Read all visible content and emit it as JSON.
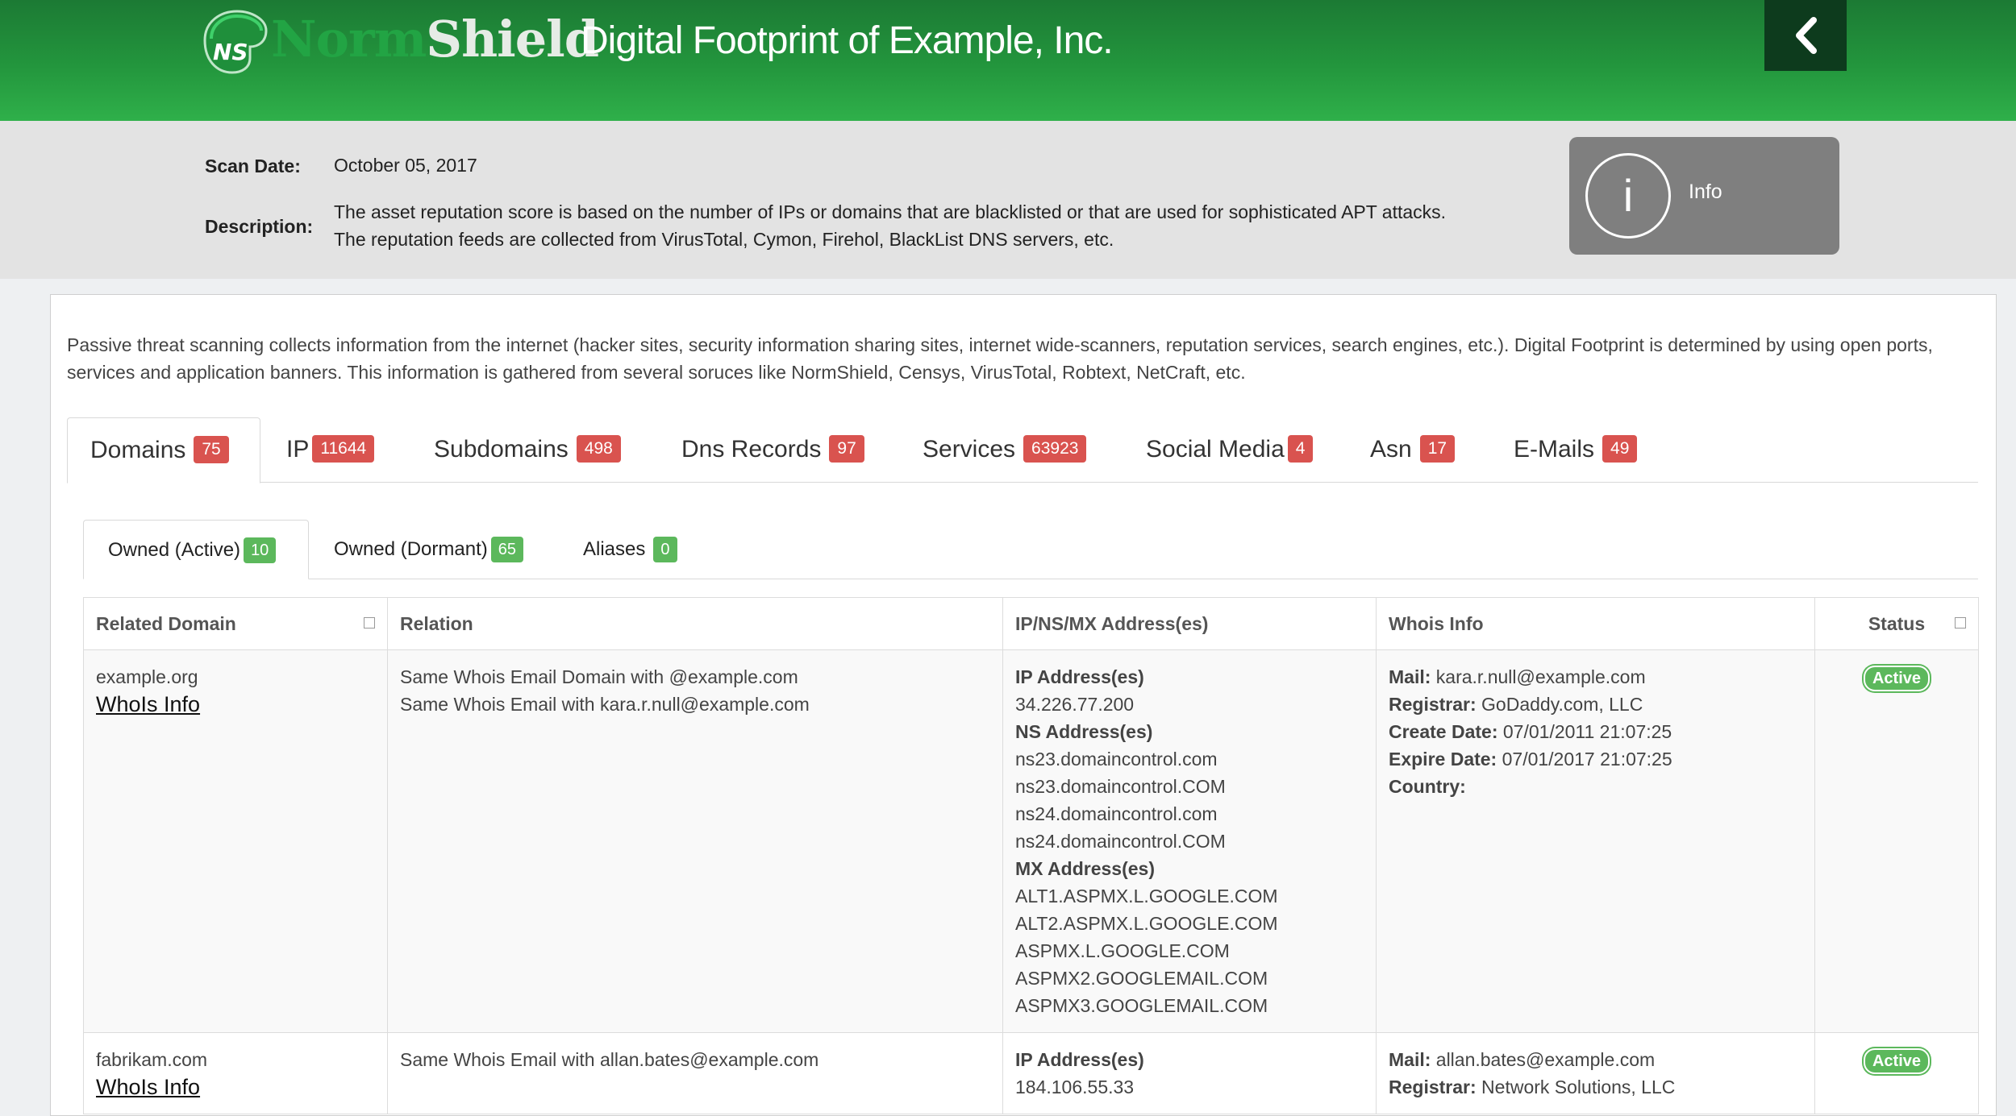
{
  "header": {
    "logo_badge": "NS",
    "logo_norm": "Norm",
    "logo_shield": "Shield",
    "title": "Digital Footprint of Example, Inc.",
    "back_icon": "chevron-left-icon"
  },
  "scan_info": {
    "scan_date_label": "Scan Date:",
    "scan_date": "October 05, 2017",
    "description_label": "Description:",
    "description_line1": "The asset reputation score is based on the number of IPs or domains that are blacklisted or that are used for sophisticated APT attacks.",
    "description_line2": "The reputation feeds are collected from VirusTotal, Cymon, Firehol, BlackList DNS servers, etc.",
    "info_icon_glyph": "i",
    "info_label": "Info"
  },
  "intro": "Passive threat scanning collects information from the internet (hacker sites, security information sharing sites, internet wide-scanners, reputation services, search engines, etc.). Digital Footprint is determined by using open ports, services and application banners. This information is gathered from several soruces like NormShield, Censys, VirusTotal, Robtext, NetCraft, etc.",
  "tabs": [
    {
      "label": "Domains",
      "count": "75"
    },
    {
      "label": "IP",
      "count": "11644"
    },
    {
      "label": "Subdomains",
      "count": "498"
    },
    {
      "label": "Dns Records",
      "count": "97"
    },
    {
      "label": "Services",
      "count": "63923"
    },
    {
      "label": "Social Media",
      "count": "4"
    },
    {
      "label": "Asn",
      "count": "17"
    },
    {
      "label": "E-Mails",
      "count": "49"
    }
  ],
  "subtabs": [
    {
      "label": "Owned (Active)",
      "count": "10"
    },
    {
      "label": "Owned (Dormant)",
      "count": "65"
    },
    {
      "label": "Aliases",
      "count": "0"
    }
  ],
  "table": {
    "columns": [
      "Related Domain",
      "Relation",
      "IP/NS/MX Address(es)",
      "Whois Info",
      "Status"
    ],
    "rows": [
      {
        "domain": "example.org",
        "whois_link": "WhoIs Info",
        "relation": [
          "Same Whois Email Domain with @example.com",
          "Same Whois Email with kara.r.null@example.com"
        ],
        "ip_head": "IP Address(es)",
        "ips": [
          "34.226.77.200"
        ],
        "ns_head": "NS Address(es)",
        "ns": [
          "ns23.domaincontrol.com",
          "ns23.domaincontrol.COM",
          "ns24.domaincontrol.com",
          "ns24.domaincontrol.COM"
        ],
        "mx_head": "MX Address(es)",
        "mx": [
          "ALT1.ASPMX.L.GOOGLE.COM",
          "ALT2.ASPMX.L.GOOGLE.COM",
          "ASPMX.L.GOOGLE.COM",
          "ASPMX2.GOOGLEMAIL.COM",
          "ASPMX3.GOOGLEMAIL.COM"
        ],
        "whois": {
          "mail_label": "Mail:",
          "mail": "kara.r.null@example.com",
          "registrar_label": "Registrar:",
          "registrar": "GoDaddy.com, LLC",
          "create_label": "Create Date:",
          "create": "07/01/2011 21:07:25",
          "expire_label": "Expire Date:",
          "expire": "07/01/2017 21:07:25",
          "country_label": "Country:",
          "country": ""
        },
        "status": "Active"
      },
      {
        "domain": "fabrikam.com",
        "whois_link": "WhoIs Info",
        "relation": [
          "Same Whois Email with allan.bates@example.com"
        ],
        "ip_head": "IP Address(es)",
        "ips": [
          "184.106.55.33"
        ],
        "whois": {
          "mail_label": "Mail:",
          "mail": "allan.bates@example.com",
          "registrar_label": "Registrar:",
          "registrar": "Network Solutions, LLC"
        },
        "status": "Active"
      }
    ]
  },
  "colors": {
    "header_green": "#23963d",
    "logo_green": "#22a444",
    "back_button": "#0d3b1d",
    "badge_red": "#d9534f",
    "badge_green": "#5cb85c",
    "info_box": "#7f7f7f"
  }
}
